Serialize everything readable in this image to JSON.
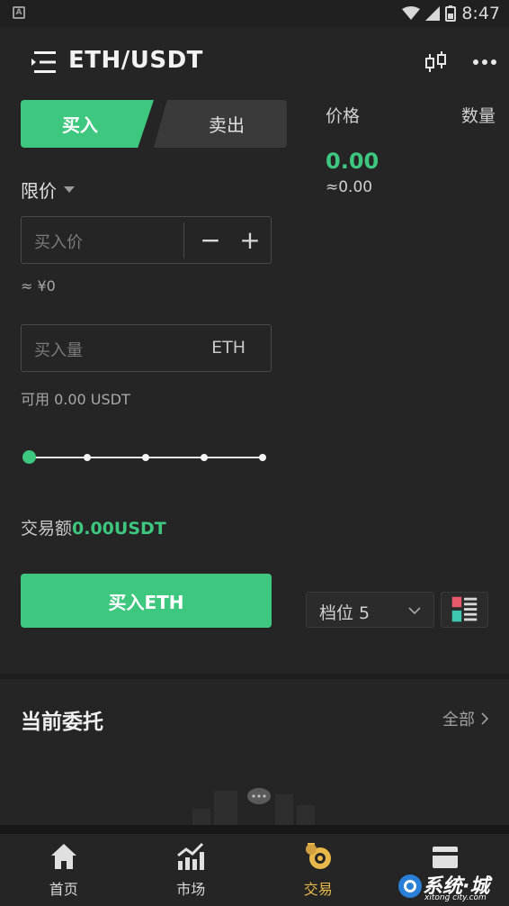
{
  "status_bar": {
    "time": "8:47"
  },
  "header": {
    "pair": "ETH/USDT"
  },
  "trade_tabs": {
    "buy": "买入",
    "sell": "卖出"
  },
  "order_form": {
    "order_type": "限价",
    "price_placeholder": "买入价",
    "minus": "−",
    "plus": "+",
    "cny_approx": "≈ ¥0",
    "amount_placeholder": "买入量",
    "amount_unit": "ETH",
    "available": "可用 0.00 USDT",
    "slider_value": 0,
    "turnover_label": "交易额",
    "turnover_value": "0.00USDT",
    "submit": "买入ETH"
  },
  "order_book": {
    "price_header": "价格",
    "qty_header": "数量",
    "last_price": "0.00",
    "last_price_approx": "≈0.00",
    "depth_label": "档位 5"
  },
  "open_orders": {
    "title": "当前委托",
    "all": "全部"
  },
  "tabbar": {
    "items": [
      {
        "label": "首页",
        "icon": "home-icon"
      },
      {
        "label": "市场",
        "icon": "market-chart-icon"
      },
      {
        "label": "交易",
        "icon": "trade-icon",
        "active": true
      },
      {
        "label": "",
        "icon": "wallet-icon"
      }
    ]
  },
  "watermark": {
    "text": "系统·城",
    "sub": "xitong city.com"
  },
  "colors": {
    "background": "#252525",
    "accent_green": "#3dc77f",
    "active_tab": "#e8b84a"
  }
}
